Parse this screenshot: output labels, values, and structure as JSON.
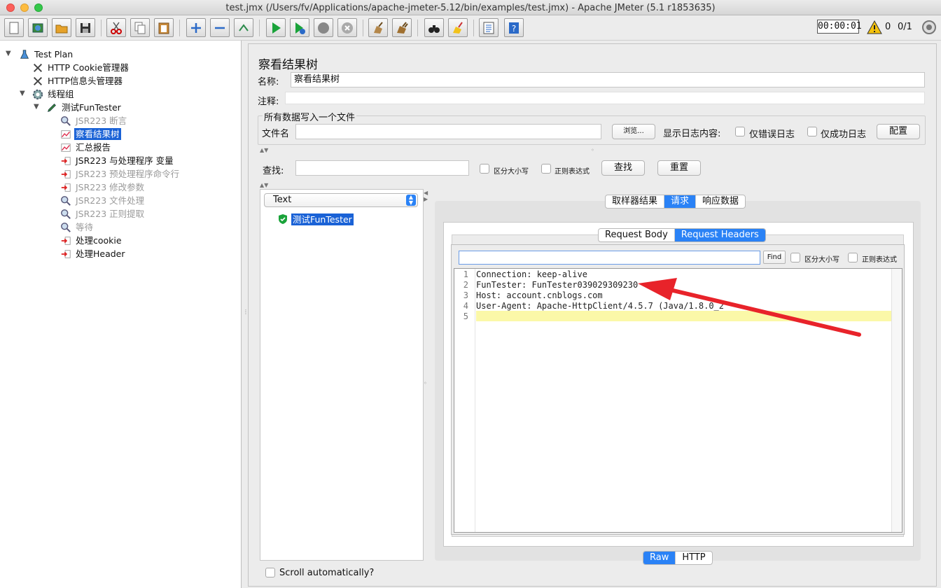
{
  "window": {
    "title": "test.jmx (/Users/fv/Applications/apache-jmeter-5.12/bin/examples/test.jmx) - Apache JMeter (5.1 r1853635)"
  },
  "toolbar": {
    "timer": "00:00:01",
    "warn_count": "0",
    "thread_count": "0/1",
    "buttons": [
      "new",
      "templates",
      "open",
      "save",
      "cut",
      "copy",
      "paste",
      "expand",
      "collapse",
      "toggle",
      "start",
      "start-no-pause",
      "stop",
      "shutdown",
      "clear",
      "clear-all",
      "search",
      "reset-search",
      "function-helper",
      "help"
    ]
  },
  "tree": {
    "items": [
      {
        "label": "Test Plan",
        "icon": "beaker-icon"
      },
      {
        "label": "HTTP Cookie管理器",
        "icon": "wrench-icon"
      },
      {
        "label": "HTTP信息头管理器",
        "icon": "wrench-icon"
      },
      {
        "label": "线程组",
        "icon": "gear-icon"
      },
      {
        "label": "测试FunTester",
        "icon": "pen-icon"
      },
      {
        "label": "JSR223 断言",
        "icon": "magnifier-icon"
      },
      {
        "label": "察看结果树",
        "icon": "chart-icon"
      },
      {
        "label": "汇总报告",
        "icon": "chart-icon"
      },
      {
        "label": "JSR223 与处理程序 变量",
        "icon": "processor-icon"
      },
      {
        "label": "JSR223 预处理程序命令行",
        "icon": "processor-icon"
      },
      {
        "label": "JSR223 修改参数",
        "icon": "processor-icon"
      },
      {
        "label": "JSR223 文件处理",
        "icon": "magnifier-icon"
      },
      {
        "label": "JSR223 正则提取",
        "icon": "magnifier-icon"
      },
      {
        "label": "等待",
        "icon": "magnifier-icon"
      },
      {
        "label": "处理cookie",
        "icon": "processor-icon"
      },
      {
        "label": "处理Header",
        "icon": "processor-icon"
      }
    ]
  },
  "panel": {
    "heading": "察看结果树",
    "name_label": "名称:",
    "name_value": "察看结果树",
    "comment_label": "注释:",
    "comment_value": "",
    "file_legend": "所有数据写入一个文件",
    "file_label": "文件名",
    "file_value": "",
    "browse_label": "浏览...",
    "log_label": "显示日志内容:",
    "errors_only_label": "仅错误日志",
    "success_only_label": "仅成功日志",
    "config_label": "配置",
    "search_label": "查找:",
    "search_value": "",
    "case_label": "区分大小写",
    "regex_label": "正则表达式",
    "find_label": "查找",
    "reset_label": "重置"
  },
  "results": {
    "renderer": "Text",
    "sample": "测试FunTester",
    "scroll_label": "Scroll automatically?"
  },
  "detail": {
    "tabs": [
      "取样器结果",
      "请求",
      "响应数据"
    ],
    "active_tab": "请求",
    "subtabs": [
      "Request Body",
      "Request Headers"
    ],
    "active_subtab": "Request Headers",
    "find_value": "",
    "find_button": "Find",
    "case_label": "区分大小写",
    "regex_label": "正则表达式",
    "lines": [
      {
        "n": "1",
        "text": "Connection: keep-alive"
      },
      {
        "n": "2",
        "text": "FunTester: FunTester039029309230"
      },
      {
        "n": "3",
        "text": "Host: account.cnblogs.com"
      },
      {
        "n": "4",
        "text": "User-Agent: Apache-HttpClient/4.5.7 (Java/1.8.0_2"
      },
      {
        "n": "5",
        "text": ""
      }
    ],
    "view_tabs": [
      "Raw",
      "HTTP"
    ],
    "active_view": "Raw"
  },
  "colors": {
    "accent": "#2a82f6",
    "selection": "#1a62d6",
    "arrow": "#e8232a",
    "highlight": "#fbf8a8"
  }
}
